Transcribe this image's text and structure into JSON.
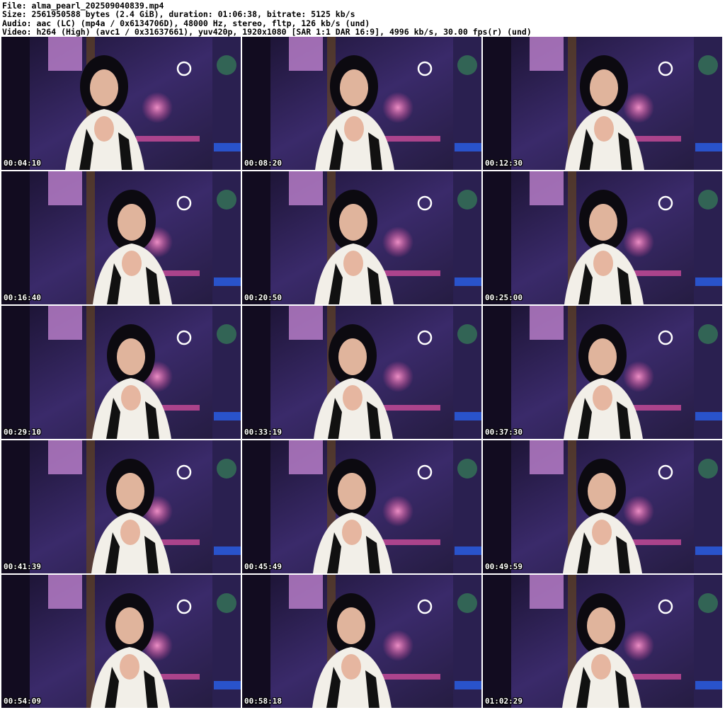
{
  "header": {
    "file": "File: alma_pearl_202509040839.mp4",
    "size": "Size: 2561950588 bytes (2.4 GiB), duration: 01:06:38, bitrate: 5125 kb/s",
    "audio": "Audio: aac (LC) (mp4a / 0x6134706D), 48000 Hz, stereo, fltp, 126 kb/s (und)",
    "video": "Video: h264 (High) (avc1 / 0x31637661), yuv420p, 1920x1080 [SAR 1:1 DAR 16:9], 4996 kb/s, 30.00 fps(r) (und)"
  },
  "thumbnails": [
    {
      "timestamp": "00:04:10"
    },
    {
      "timestamp": "00:08:20"
    },
    {
      "timestamp": "00:12:30"
    },
    {
      "timestamp": "00:16:40"
    },
    {
      "timestamp": "00:20:50"
    },
    {
      "timestamp": "00:25:00"
    },
    {
      "timestamp": "00:29:10"
    },
    {
      "timestamp": "00:33:19"
    },
    {
      "timestamp": "00:37:30"
    },
    {
      "timestamp": "00:41:39"
    },
    {
      "timestamp": "00:45:49"
    },
    {
      "timestamp": "00:49:59"
    },
    {
      "timestamp": "00:54:09"
    },
    {
      "timestamp": "00:58:18"
    },
    {
      "timestamp": "01:02:29"
    }
  ]
}
